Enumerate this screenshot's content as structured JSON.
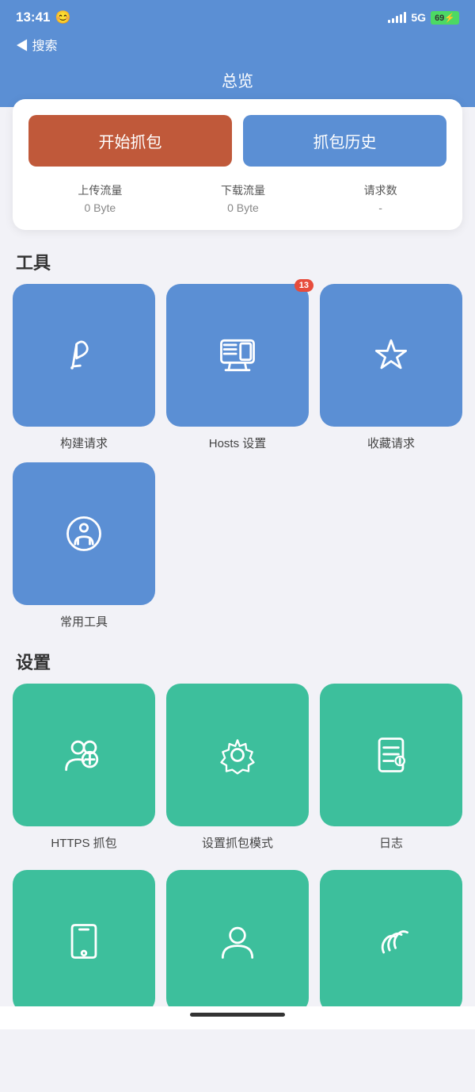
{
  "statusBar": {
    "time": "13:41",
    "emoji": "😊",
    "network": "5G",
    "battery": "69%",
    "search": "◀ 搜索"
  },
  "header": {
    "title": "总览"
  },
  "card": {
    "startBtn": "开始抓包",
    "historyBtn": "抓包历史",
    "stats": [
      {
        "label": "上传流量",
        "value": "0 Byte"
      },
      {
        "label": "下载流量",
        "value": "0 Byte"
      },
      {
        "label": "请求数",
        "value": "-"
      }
    ]
  },
  "toolsSection": {
    "title": "工具",
    "items": [
      {
        "id": "build-request",
        "label": "构建请求",
        "icon": "pen"
      },
      {
        "id": "hosts-settings",
        "label": "Hosts 设置",
        "badge": "13",
        "icon": "monitor"
      },
      {
        "id": "saved-requests",
        "label": "收藏请求",
        "icon": "star"
      },
      {
        "id": "common-tools",
        "label": "常用工具",
        "icon": "tools"
      }
    ]
  },
  "settingsSection": {
    "title": "设置",
    "items": [
      {
        "id": "https-capture",
        "label": "HTTPS 抓包",
        "icon": "people"
      },
      {
        "id": "capture-mode",
        "label": "设置抓包模式",
        "icon": "gear"
      },
      {
        "id": "logs",
        "label": "日志",
        "icon": "doc"
      }
    ]
  }
}
